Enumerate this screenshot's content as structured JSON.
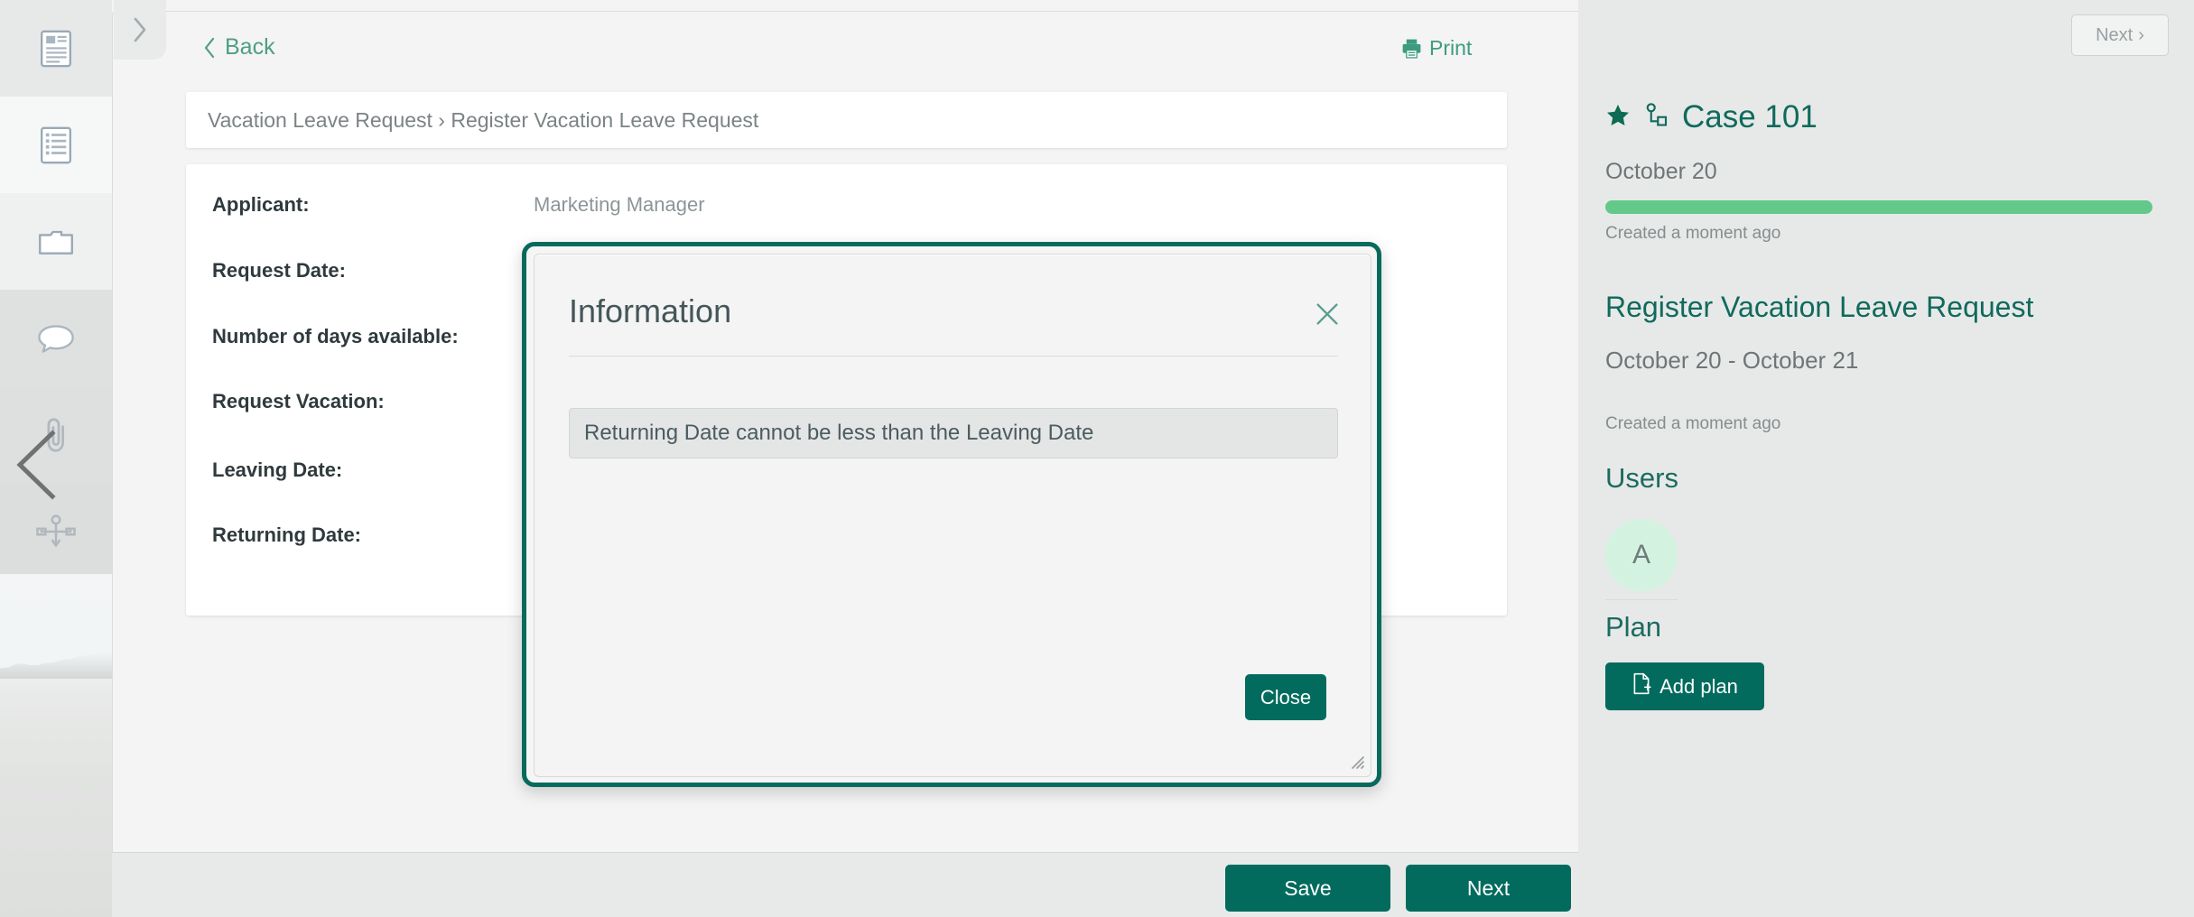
{
  "rail": {
    "items": [
      {
        "name": "form-icon",
        "label": "Form"
      },
      {
        "name": "list-icon",
        "label": "List"
      },
      {
        "name": "folder-icon",
        "label": "Documents"
      },
      {
        "name": "comment-icon",
        "label": "Comments"
      },
      {
        "name": "paperclip-icon",
        "label": "Attachments"
      },
      {
        "name": "process-icon",
        "label": "Process"
      }
    ],
    "collapse_label": "Collapse"
  },
  "toolbar": {
    "back_label": "Back",
    "print_label": "Print",
    "expand_label": "Expand"
  },
  "breadcrumb": {
    "text": "Vacation Leave Request › Register Vacation Leave Request"
  },
  "form": {
    "rows": [
      {
        "label": "Applicant:",
        "value": "Marketing Manager",
        "type": "text"
      },
      {
        "label": "Request Date:",
        "value": "",
        "type": "text"
      },
      {
        "label": "Number of days available:",
        "value": "",
        "type": "text"
      },
      {
        "label": "Request Vacation:",
        "value": "",
        "type": "text"
      },
      {
        "label": "Leaving Date:",
        "value": "",
        "type": "input"
      },
      {
        "label": "Returning Date:",
        "value": "",
        "type": "text"
      }
    ]
  },
  "footer": {
    "save_label": "Save",
    "next_label": "Next"
  },
  "sidebar": {
    "next_label": "Next",
    "next_chevron": "›",
    "case_title": "Case 101",
    "case_date": "October 20",
    "progress_percent": 100,
    "case_created": "Created a moment ago",
    "task_title": "Register Vacation Leave Request",
    "task_dates": "October 20 - October 21",
    "task_created": "Created a moment ago",
    "users_heading": "Users",
    "avatar_initial": "A",
    "plan_heading": "Plan",
    "add_plan_label": "Add plan"
  },
  "dialog": {
    "title": "Information",
    "message": "Returning Date cannot be less than the Leaving Date",
    "close_button_label": "Close",
    "close_icon": "close-icon"
  },
  "colors": {
    "brand_dark_green": "#026b5d",
    "brand_teal": "#0f6a5d",
    "progress_green": "#63c98a",
    "link_green": "#4e9e85",
    "dialog_border": "#066a5c",
    "avatar_bg": "#d3f3e0"
  }
}
